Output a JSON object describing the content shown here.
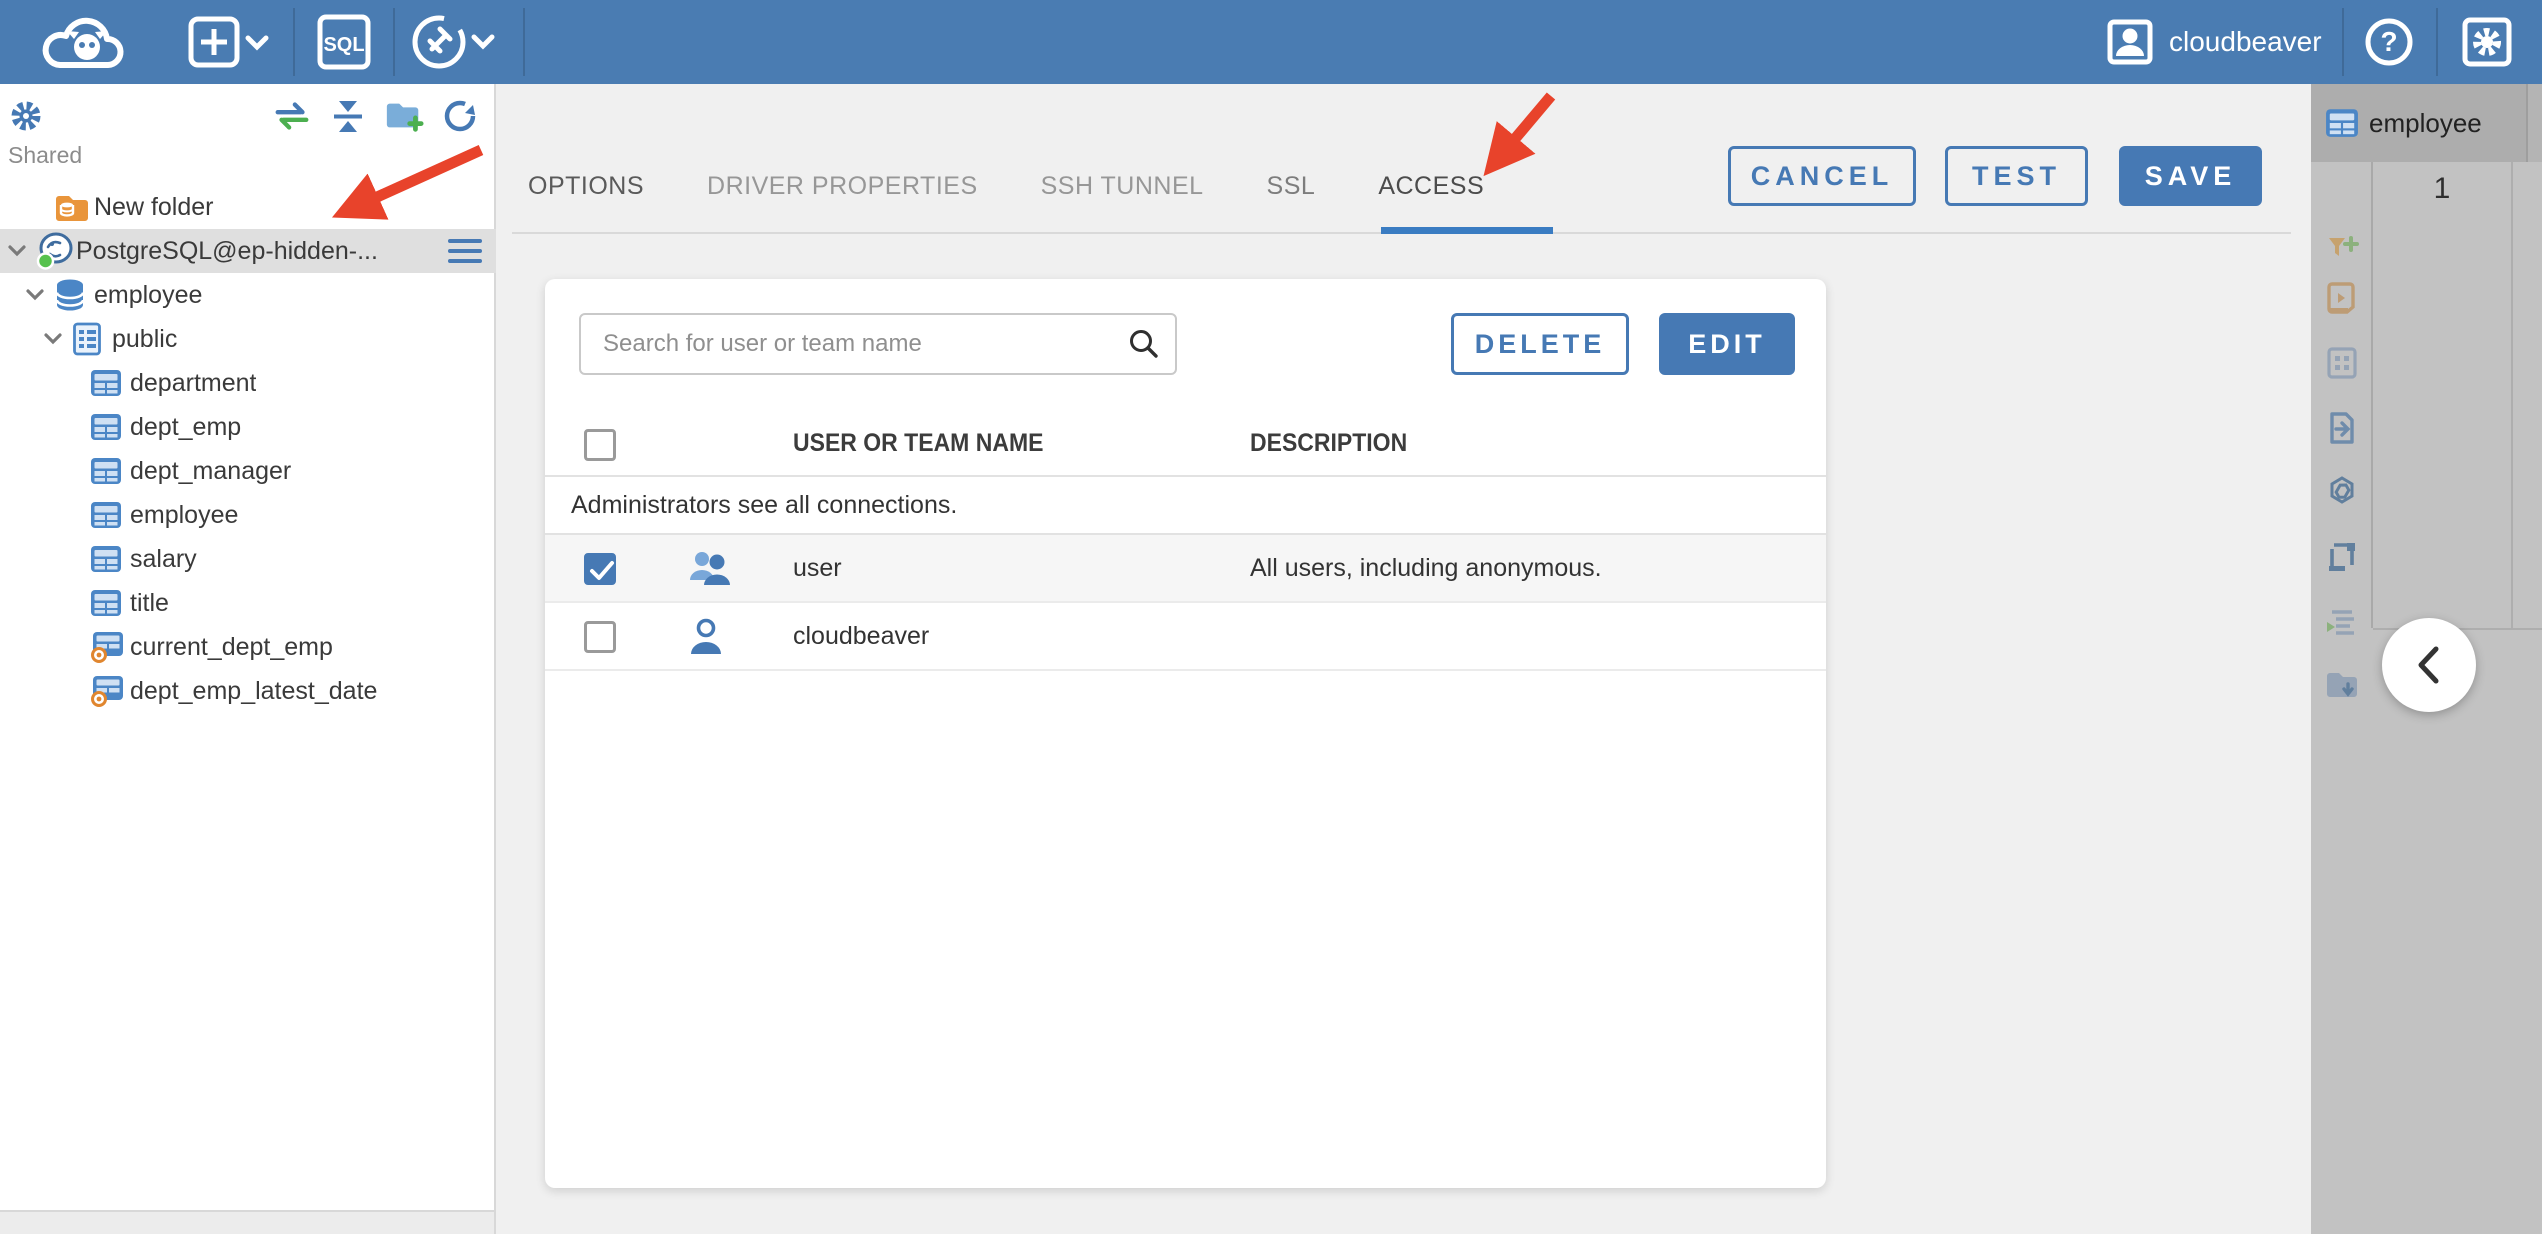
{
  "header": {
    "user_name": "cloudbeaver",
    "sql_badge": "SQL"
  },
  "sidebar": {
    "section_label": "Shared",
    "items": [
      {
        "label": "New folder",
        "type": "folder"
      },
      {
        "label": "PostgreSQL@ep-hidden-...",
        "type": "connection",
        "selected": true
      },
      {
        "label": "employee",
        "type": "database"
      },
      {
        "label": "public",
        "type": "schema"
      },
      {
        "label": "department",
        "type": "table"
      },
      {
        "label": "dept_emp",
        "type": "table"
      },
      {
        "label": "dept_manager",
        "type": "table"
      },
      {
        "label": "employee",
        "type": "table"
      },
      {
        "label": "salary",
        "type": "table"
      },
      {
        "label": "title",
        "type": "table"
      },
      {
        "label": "current_dept_emp",
        "type": "view"
      },
      {
        "label": "dept_emp_latest_date",
        "type": "view"
      }
    ]
  },
  "dialog": {
    "tabs": [
      {
        "label": "OPTIONS",
        "active": false
      },
      {
        "label": "DRIVER PROPERTIES",
        "active": false
      },
      {
        "label": "SSH TUNNEL",
        "active": false
      },
      {
        "label": "SSL",
        "active": false
      },
      {
        "label": "ACCESS",
        "active": true
      }
    ],
    "actions": {
      "cancel": "CANCEL",
      "test": "TEST",
      "save": "SAVE"
    },
    "access": {
      "search_placeholder": "Search for user or team name",
      "delete_label": "DELETE",
      "edit_label": "EDIT",
      "columns": {
        "name": "USER OR TEAM NAME",
        "description": "DESCRIPTION"
      },
      "info_row": "Administrators see all connections.",
      "rows": [
        {
          "name": "user",
          "description": "All users, including anonymous.",
          "checked": true,
          "kind": "team"
        },
        {
          "name": "cloudbeaver",
          "description": "",
          "checked": false,
          "kind": "user"
        }
      ]
    }
  },
  "right_panel": {
    "tab_label": "employee",
    "row_number": "1"
  },
  "colors": {
    "header_blue": "#4a7cb2",
    "accent": "#4679b4",
    "tab_underline": "#3a7cc2",
    "arrow_red": "#e8432b",
    "selected_row_bg": "#dfdfdf"
  }
}
